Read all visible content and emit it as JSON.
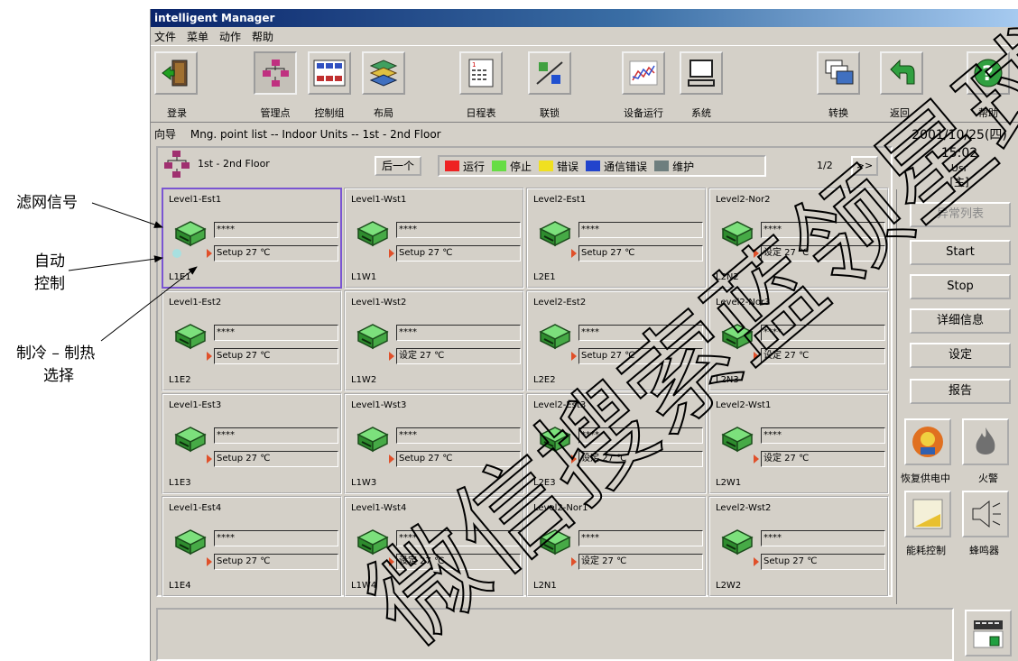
{
  "annotations": {
    "filter_signal": "滤网信号",
    "auto_control_1": "自动",
    "auto_control_2": "控制",
    "cool_heat_1": "制冷 – 制热",
    "cool_heat_2": "选择"
  },
  "window": {
    "title": "intelligent Manager",
    "menu": [
      "文件",
      "菜单",
      "动作",
      "帮助"
    ]
  },
  "toolbar": {
    "login": "登录",
    "mgmt_point": "管理点",
    "control_group": "控制组",
    "layout": "布局",
    "schedule": "日程表",
    "interlock": "联锁",
    "equipment_run": "设备运行",
    "system": "系统",
    "switch": "转换",
    "back": "返回",
    "help": "帮助"
  },
  "breadcrumb": {
    "label": "向导",
    "path": "Mng. point list -- Indoor Units -- 1st - 2nd Floor"
  },
  "header": {
    "floor": "1st - 2nd Floor",
    "back_button": "后一个",
    "page": "1/2",
    "next": ">>"
  },
  "legend": [
    {
      "label": "运行",
      "color": "#ee2222"
    },
    {
      "label": "停止",
      "color": "#66dd44"
    },
    {
      "label": "错误",
      "color": "#f0e020"
    },
    {
      "label": "通信错误",
      "color": "#2244cc"
    },
    {
      "label": "维护",
      "color": "#6e7e7e"
    }
  ],
  "units": [
    {
      "name": "Level1-Est1",
      "value": "****",
      "setting": "Setup 27 ℃",
      "code": "L1E1"
    },
    {
      "name": "Level1-Wst1",
      "value": "****",
      "setting": "Setup 27 ℃",
      "code": "L1W1"
    },
    {
      "name": "Level2-Est1",
      "value": "****",
      "setting": "Setup 27 ℃",
      "code": "L2E1"
    },
    {
      "name": "Level2-Nor2",
      "value": "****",
      "setting": "设定 27 ℃",
      "code": "L2N2"
    },
    {
      "name": "Level1-Est2",
      "value": "****",
      "setting": "Setup 27 ℃",
      "code": "L1E2"
    },
    {
      "name": "Level1-Wst2",
      "value": "****",
      "setting": "设定 27 ℃",
      "code": "L1W2"
    },
    {
      "name": "Level2-Est2",
      "value": "****",
      "setting": "Setup 27 ℃",
      "code": "L2E2"
    },
    {
      "name": "Level2-Nor3",
      "value": "****",
      "setting": "设定 27 ℃",
      "code": "L2N3"
    },
    {
      "name": "Level1-Est3",
      "value": "****",
      "setting": "Setup 27 ℃",
      "code": "L1E3"
    },
    {
      "name": "Level1-Wst3",
      "value": "****",
      "setting": "Setup 27 ℃",
      "code": "L1W3"
    },
    {
      "name": "Level2-Est3",
      "value": "****",
      "setting": "设定 27 ℃",
      "code": "L2E3"
    },
    {
      "name": "Level2-Wst1",
      "value": "****",
      "setting": "设定 27 ℃",
      "code": "L2W1"
    },
    {
      "name": "Level1-Est4",
      "value": "****",
      "setting": "Setup 27 ℃",
      "code": "L1E4"
    },
    {
      "name": "Level1-Wst4",
      "value": "****",
      "setting": "设定 27 ℃",
      "code": "L1W4"
    },
    {
      "name": "Level2-Nor1",
      "value": "****",
      "setting": "设定 27 ℃",
      "code": "L2N1"
    },
    {
      "name": "Level2-Wst2",
      "value": "****",
      "setting": "Setup 27 ℃",
      "code": "L2W2"
    }
  ],
  "datetime": {
    "date": "2001/10/25(四)",
    "time": "15:02",
    "user": "Usr",
    "role": "[主]"
  },
  "right_buttons": {
    "alarm_list": "异常列表",
    "start": "Start",
    "stop": "Stop",
    "details": "详细信息",
    "settings": "设定",
    "report": "报告"
  },
  "icons": {
    "power_restore": "恢复供电中",
    "fire": "火警",
    "energy": "能耗控制",
    "buzzer": "蜂鸣器"
  },
  "watermark": "微信搜索蓝领星球"
}
